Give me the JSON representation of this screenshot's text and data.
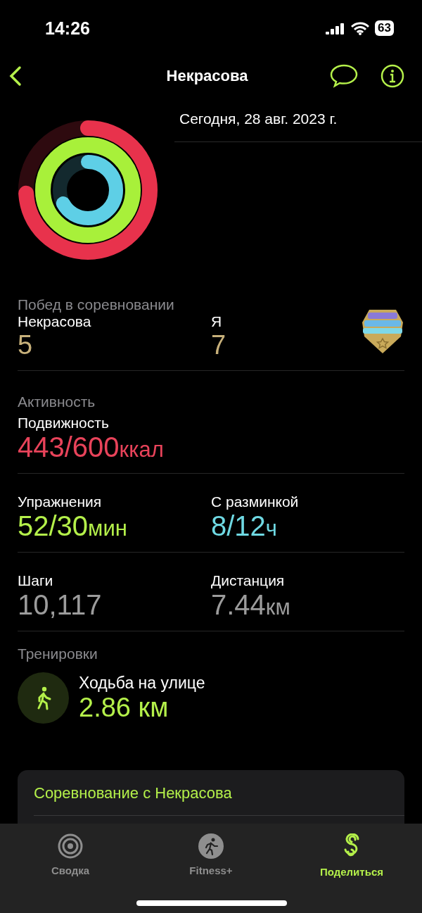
{
  "status_bar": {
    "time": "14:26",
    "battery": "63"
  },
  "nav": {
    "title": "Некрасова"
  },
  "date": "Сегодня, 28 авг. 2023 г.",
  "competition": {
    "title": "Побед в соревновании",
    "participants": [
      {
        "name": "Некрасова",
        "score": "5"
      },
      {
        "name": "Я",
        "score": "7"
      }
    ]
  },
  "activity": {
    "title": "Активность",
    "rows": [
      [
        {
          "label": "Подвижность",
          "value": "443/600",
          "unit": "ккал",
          "color": "#e8435a"
        }
      ],
      [
        {
          "label": "Упражнения",
          "value": "52/30",
          "unit": "мин",
          "color": "#b4f04a"
        },
        {
          "label": "С разминкой",
          "value": "8/12",
          "unit": "ч",
          "color": "#6fd9e3"
        }
      ],
      [
        {
          "label": "Шаги",
          "value": "10,117",
          "color": "#9c9c9c"
        },
        {
          "label": "Дистанция",
          "value": "7.44",
          "unit": "км",
          "color": "#9c9c9c"
        }
      ]
    ]
  },
  "workouts": {
    "title": "Тренировки",
    "items": [
      {
        "name": "Ходьба на улице",
        "value": "2.86 км"
      }
    ]
  },
  "actions": [
    "Соревнование с Некрасова"
  ],
  "tabs": [
    {
      "label": "Сводка",
      "kind": "summary",
      "selected": false
    },
    {
      "label": "Fitness+",
      "kind": "fitness",
      "selected": false
    },
    {
      "label": "Поделиться",
      "kind": "sharing",
      "selected": true
    }
  ]
}
